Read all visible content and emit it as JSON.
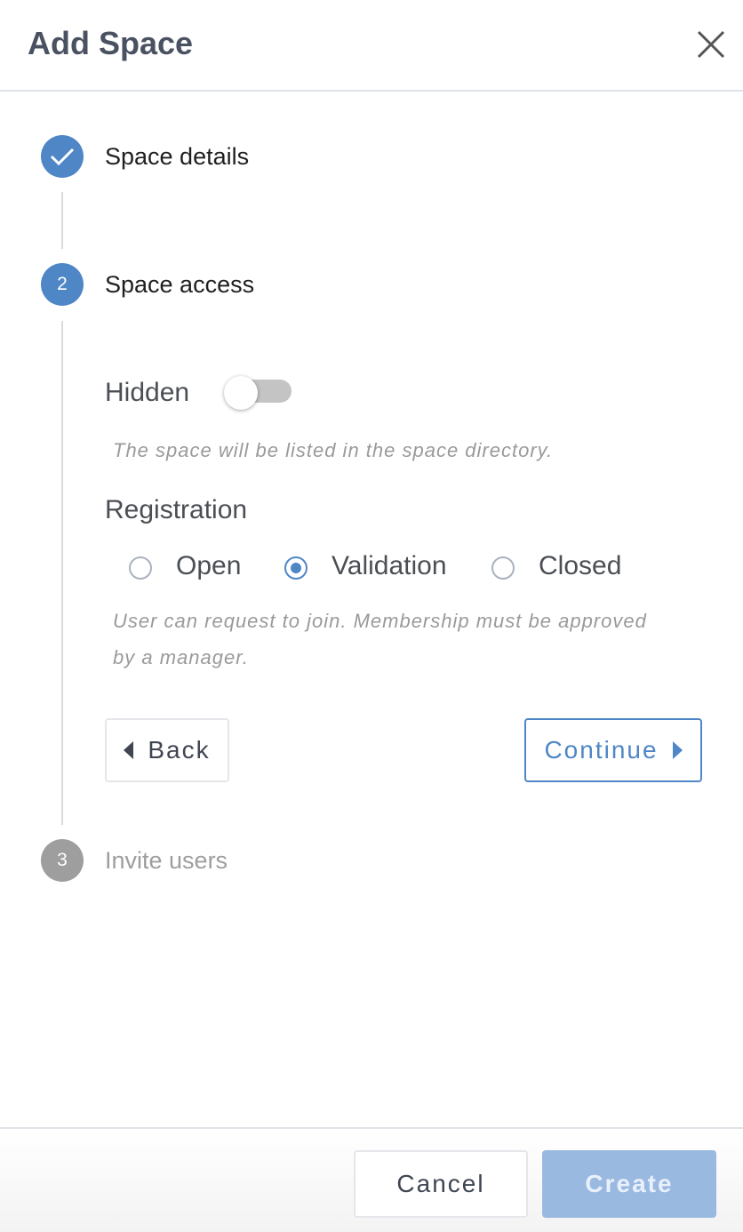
{
  "header": {
    "title": "Add Space",
    "close_icon": "close-icon"
  },
  "steps": [
    {
      "number": "",
      "label": "Space details",
      "state": "completed",
      "icon": "check-icon"
    },
    {
      "number": "2",
      "label": "Space access",
      "state": "active"
    },
    {
      "number": "3",
      "label": "Invite users",
      "state": "pending"
    }
  ],
  "access": {
    "hidden_label": "Hidden",
    "hidden_on": false,
    "hidden_help": "The space will be listed in the space directory.",
    "registration_label": "Registration",
    "registration_options": [
      "Open",
      "Validation",
      "Closed"
    ],
    "registration_selected": "Validation",
    "registration_help_line1": "User can request to join. Membership must be approved",
    "registration_help_line2": "by a manager.",
    "back_label": "Back",
    "continue_label": "Continue"
  },
  "footer": {
    "cancel_label": "Cancel",
    "create_label": "Create"
  },
  "colors": {
    "accent": "#4f86c6",
    "pending": "#9e9e9e",
    "title": "#4a5262",
    "create_disabled": "#9ab9e0"
  }
}
